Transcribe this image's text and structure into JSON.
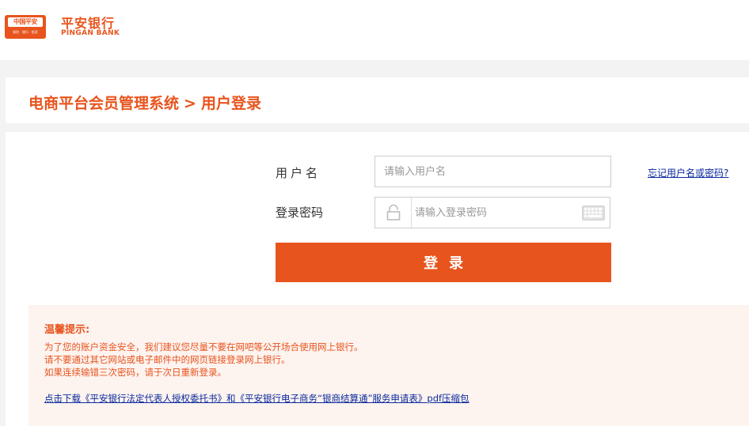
{
  "header": {
    "logo_text": "中国平安",
    "logo_sub": "保险 · 银行 · 投资",
    "bank_name_cn": "平安银行",
    "bank_name_en": "PINGAN BANK"
  },
  "breadcrumb": {
    "system": "电商平台会员管理系统",
    "separator": ">",
    "page": "用户登录"
  },
  "form": {
    "username_label": "用户名",
    "username_placeholder": "请输入用户名",
    "password_label": "登录密码",
    "password_placeholder": "请输入登录密码",
    "forgot_link": "忘记用户名或密码?",
    "login_button": "登录"
  },
  "tips": {
    "title": "温馨提示:",
    "lines": [
      "为了您的账户资金安全，我们建议您尽量不要在网吧等公开场合使用网上银行。",
      "请不要通过其它网站或电子邮件中的网页链接登录网上银行。",
      "如果连续输错三次密码，请于次日重新登录。"
    ],
    "download_link": "点击下载《平安银行法定代表人授权委托书》和《平安银行电子商务“银商结算通”服务申请表》pdf压缩包"
  },
  "colors": {
    "brand_orange": "#e8541d",
    "link_blue": "#0b2a9e",
    "tips_background": "#fdf3ef",
    "page_background": "#f3f3f3"
  }
}
